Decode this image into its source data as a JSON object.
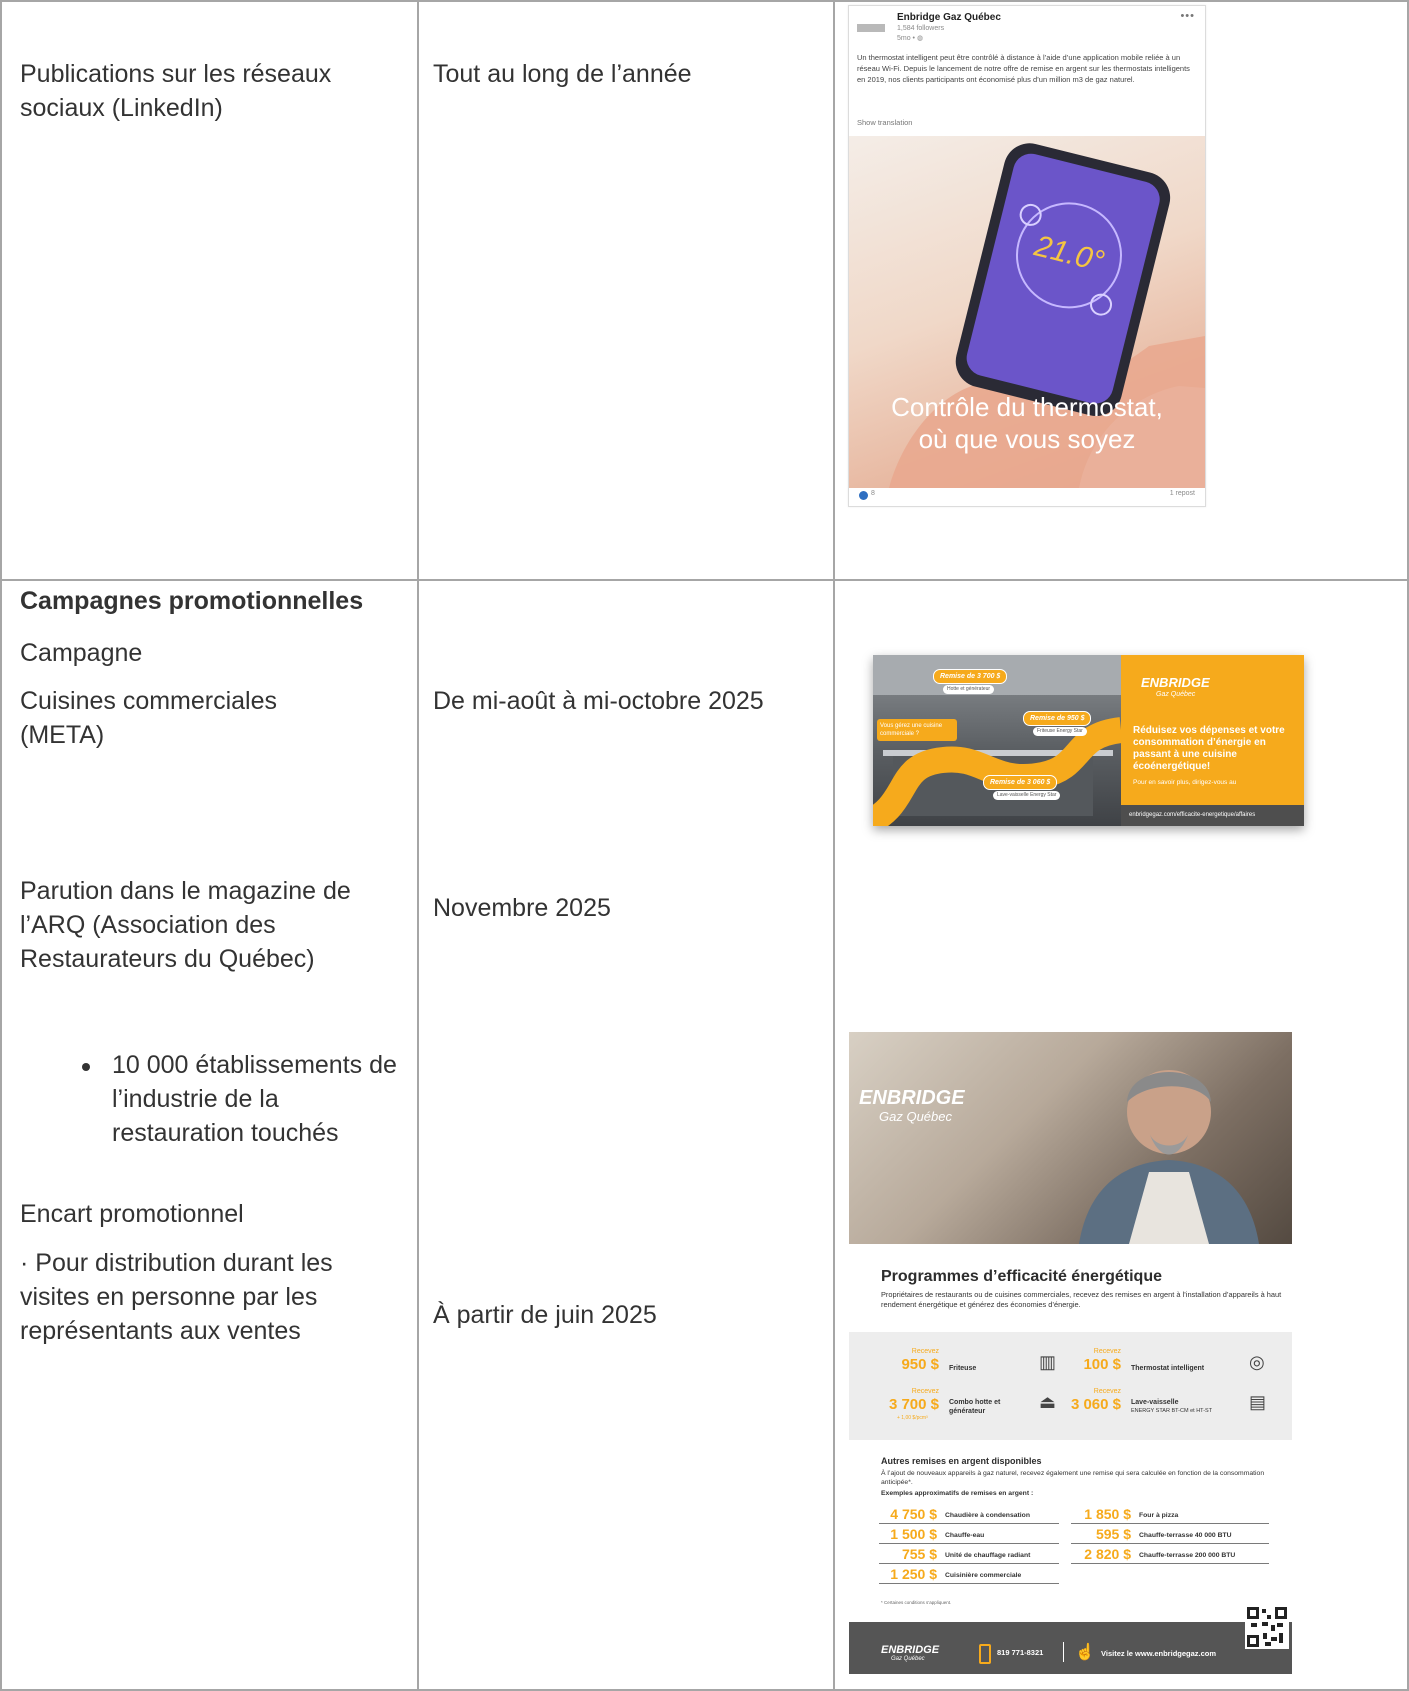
{
  "rows": {
    "linkedin": {
      "activity": "Publications sur les réseaux sociaux (LinkedIn)",
      "period": "Tout au long de l’année"
    },
    "campaigns": {
      "heading": "Campagnes promotionnelles",
      "label": "Campagne",
      "meta_activity": "Cuisines commerciales (META)",
      "meta_period": "De mi-août à mi-octobre 2025",
      "arq_activity": "Parution dans le magazine de l’ARQ (Association des Restaurateurs du Québec)",
      "arq_period": "Novembre 2025",
      "arq_bullet": "10 000 établissements de l’industrie de la restauration touchés",
      "insert_activity": "Encart promotionnel",
      "insert_detail": "· Pour distribution durant les visites en personne par les représentants aux ventes",
      "insert_period": "À partir de juin 2025"
    }
  },
  "linkedin_post": {
    "company": "Enbridge Gaz Québec",
    "followers": "1,584 followers",
    "time": "5mo • ",
    "more": "•••",
    "body": "Un thermostat intelligent peut être contrôlé à distance à l’aide d’une application mobile reliée à un réseau Wi-Fi. Depuis le lancement de notre offre de remise en argent sur les thermostats intelligents en 2019, nos clients participants ont économisé plus d’un million m3 de gaz naturel.",
    "translate": "Show translation",
    "thermostat_value": "21.0°",
    "caption_line1": "Contrôle du thermostat,",
    "caption_line2": "où que vous soyez",
    "likes": "8",
    "reposts": "1 repost"
  },
  "meta_ad": {
    "brand": "ENBRIDGE",
    "brand_sub": "Gaz Québec",
    "headline": "Réduisez vos dépenses et votre consommation d’énergie en passant à une cuisine écoénergétique!",
    "more": "Pour en savoir plus, dirigez-vous au",
    "url": "enbridgegaz.com/efficacite-energetique/affaires",
    "question": "Vous gérez une cuisine commerciale ?",
    "pill1": "Remise de 3 700 $",
    "tag1": "Hotte et générateur",
    "pill2": "Remise de 950 $",
    "tag2": "Friteuse Energy Star",
    "pill3": "Remise de 3 060 $",
    "tag3": "Lave-vaisselle Energy Star"
  },
  "flyer": {
    "brand": "ENBRIDGE",
    "brand_sub": "Gaz Québec",
    "title": "Programmes d’efficacité énergétique",
    "intro": "Propriétaires de restaurants ou de cuisines commerciales, recevez des remises en argent à l’installation d’appareils à haut rendement énergétique et générez des économies d’énergie.",
    "rebates": [
      {
        "label": "Recevez",
        "amount": "950 $",
        "item": "Friteuse",
        "note": ""
      },
      {
        "label": "Recevez",
        "amount": "100 $",
        "item": "Thermostat intelligent",
        "note": ""
      },
      {
        "label": "Recevez",
        "amount": "3 700 $",
        "item": "Combo hotte et générateur",
        "note": "+ 1,00 $/pcm³"
      },
      {
        "label": "Recevez",
        "amount": "3 060 $",
        "item": "Lave-vaisselle",
        "note": "ENERGY STAR BT-CM et HT-ST"
      }
    ],
    "other_title": "Autres remises en argent disponibles",
    "other_text": "À l’ajout de nouveaux appareils à gaz naturel, recevez également une remise qui sera calculée en fonction de la consommation anticipée*.",
    "examples_title": "Exemples approximatifs de remises en argent :",
    "examples": [
      {
        "amount": "4 750 $",
        "item": "Chaudière à condensation"
      },
      {
        "amount": "1 850 $",
        "item": "Four à pizza"
      },
      {
        "amount": "1 500 $",
        "item": "Chauffe-eau"
      },
      {
        "amount": "595 $",
        "item": "Chauffe-terrasse 40 000 BTU"
      },
      {
        "amount": "755 $",
        "item": "Unité de chauffage radiant"
      },
      {
        "amount": "2 820 $",
        "item": "Chauffe-terrasse 200 000 BTU"
      },
      {
        "amount": "1 250 $",
        "item": "Cuisinière commerciale"
      }
    ],
    "footnote": "* Certaines conditions s’appliquent.",
    "phone": "819 771-8321",
    "site": "Visitez le www.enbridgegaz.com"
  },
  "colors": {
    "accent": "#f6aa1c",
    "grid": "#a6a6a6",
    "text": "#333333",
    "footer": "#555555"
  }
}
